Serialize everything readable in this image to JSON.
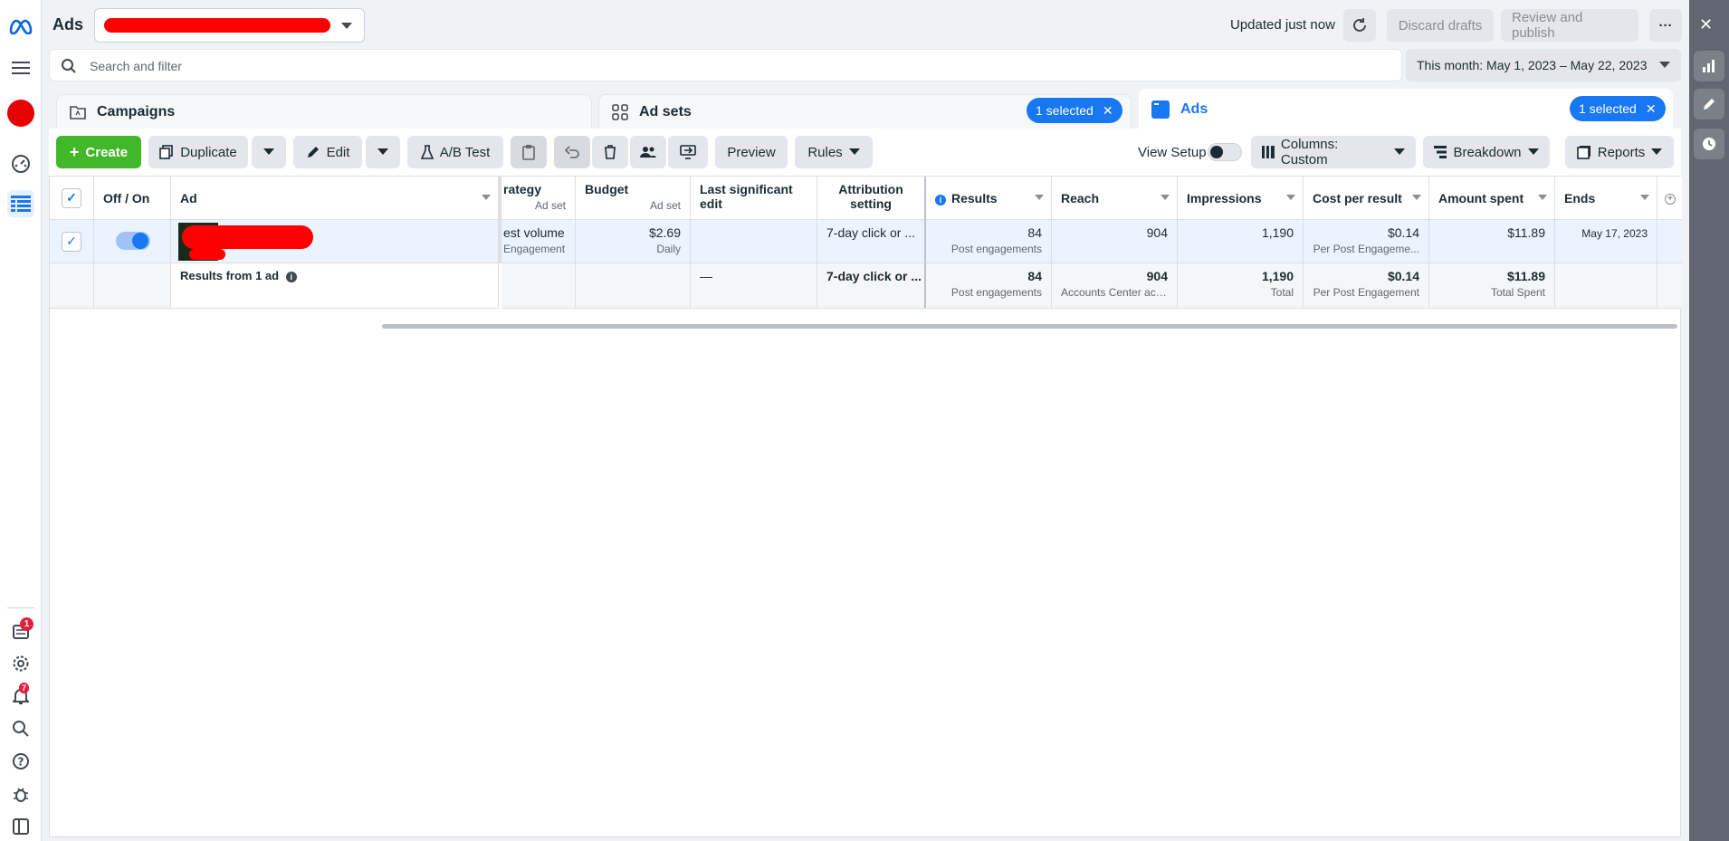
{
  "topbar": {
    "app_title": "Ads",
    "status_text": "Updated just now",
    "discard_label": "Discard drafts",
    "review_label": "Review and publish",
    "more_label": "···"
  },
  "search": {
    "placeholder": "Search and filter",
    "date_range": "This month: May 1, 2023 – May 22, 2023"
  },
  "tabs": {
    "campaigns": "Campaigns",
    "adsets": "Ad sets",
    "adsets_selected": "1 selected",
    "ads": "Ads",
    "ads_selected": "1 selected"
  },
  "toolbar": {
    "create": "Create",
    "duplicate": "Duplicate",
    "edit": "Edit",
    "ab_test": "A/B Test",
    "preview": "Preview",
    "rules": "Rules",
    "view_setup": "View Setup",
    "columns": "Columns: Custom",
    "breakdown": "Breakdown",
    "reports": "Reports"
  },
  "table": {
    "headers": {
      "offon": "Off / On",
      "ad": "Ad",
      "strategy": "rategy",
      "strategy_sub": "Ad set",
      "budget": "Budget",
      "budget_sub": "Ad set",
      "last_edit": "Last significant edit",
      "attribution": "Attribution setting",
      "results": "Results",
      "reach": "Reach",
      "impressions": "Impressions",
      "cpr": "Cost per result",
      "spent": "Amount spent",
      "ends": "Ends"
    },
    "row": {
      "toggle_on": true,
      "strategy": "est volume",
      "strategy_sub": "Engagement",
      "budget": "$2.69",
      "budget_sub": "Daily",
      "last_edit": "",
      "attribution": "7-day click or ...",
      "results": "84",
      "results_sub": "Post engagements",
      "reach": "904",
      "impressions": "1,190",
      "cpr": "$0.14",
      "cpr_sub": "Per Post Engageme...",
      "spent": "$11.89",
      "ends": "May 17, 2023"
    },
    "summary": {
      "label": "Results from 1 ad",
      "last_edit": "—",
      "attribution": "7-day click or ...",
      "results": "84",
      "results_sub": "Post engagements",
      "reach": "904",
      "reach_sub": "Accounts Center acc...",
      "impressions": "1,190",
      "impressions_sub": "Total",
      "cpr": "$0.14",
      "cpr_sub": "Per Post Engagement",
      "spent": "$11.89",
      "spent_sub": "Total Spent"
    }
  },
  "rail": {
    "inbox_badge": "1",
    "notif_badge": "7"
  },
  "colors": {
    "accent": "#1877f2",
    "create_green": "#42b72a",
    "redaction_red": "#ff0000"
  }
}
